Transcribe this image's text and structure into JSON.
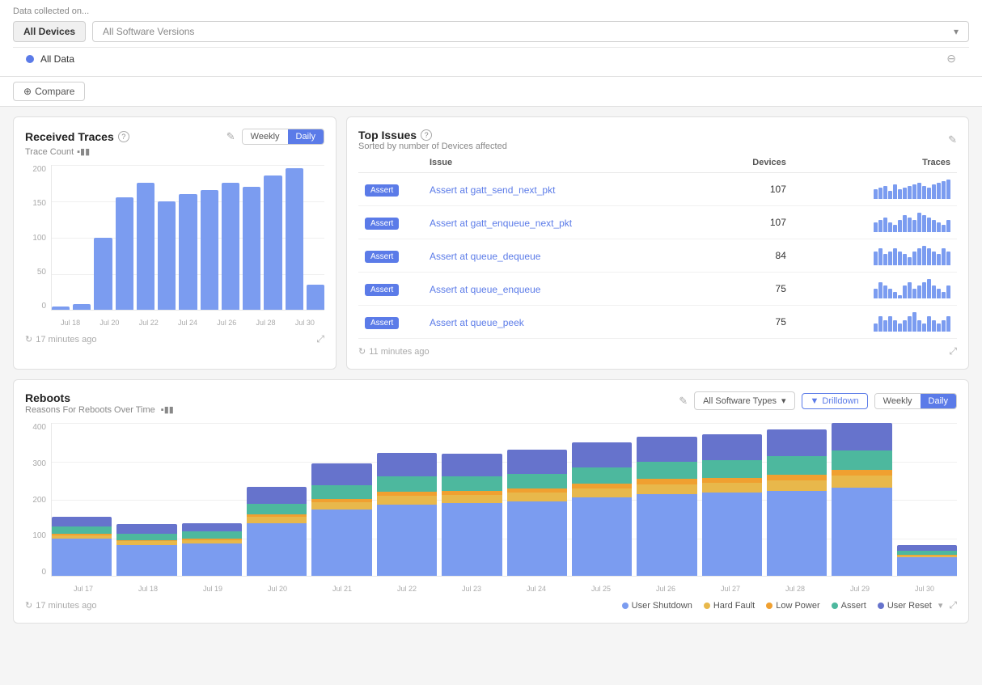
{
  "topbar": {
    "title": "Data collected on...",
    "all_devices_label": "All Devices",
    "all_software_versions_placeholder": "All Software Versions",
    "all_data_label": "All Data",
    "compare_label": "Compare"
  },
  "received_traces": {
    "title": "Received Traces",
    "subtitle": "Trace Count",
    "help": "?",
    "weekly_label": "Weekly",
    "daily_label": "Daily",
    "refresh_text": "17 minutes ago",
    "y_labels": [
      "200",
      "150",
      "100",
      "50",
      "0"
    ],
    "x_labels": [
      "Jul 18",
      "Jul 20",
      "Jul 22",
      "Jul 24",
      "Jul 26",
      "Jul 28",
      "Jul 30"
    ],
    "bars": [
      5,
      8,
      100,
      155,
      175,
      150,
      160,
      165,
      175,
      170,
      185,
      195,
      35
    ]
  },
  "top_issues": {
    "title": "Top Issues",
    "help": "?",
    "subtitle": "Sorted by number of Devices affected",
    "col_issue": "Issue",
    "col_devices": "Devices",
    "col_traces": "Traces",
    "refresh_text": "11 minutes ago",
    "rows": [
      {
        "badge": "Assert",
        "name": "Assert at gatt_send_next_pkt",
        "devices": 107,
        "bars": [
          6,
          7,
          8,
          5,
          9,
          6,
          7,
          8,
          9,
          10,
          8,
          7,
          9,
          10,
          11,
          12
        ]
      },
      {
        "badge": "Assert",
        "name": "Assert at gatt_enqueue_next_pkt",
        "devices": 107,
        "bars": [
          4,
          5,
          6,
          4,
          3,
          5,
          7,
          6,
          5,
          8,
          7,
          6,
          5,
          4,
          3,
          5
        ]
      },
      {
        "badge": "Assert",
        "name": "Assert at queue_dequeue",
        "devices": 84,
        "bars": [
          5,
          6,
          4,
          5,
          6,
          5,
          4,
          3,
          5,
          6,
          7,
          6,
          5,
          4,
          6,
          5
        ]
      },
      {
        "badge": "Assert",
        "name": "Assert at queue_enqueue",
        "devices": 75,
        "bars": [
          3,
          5,
          4,
          3,
          2,
          1,
          4,
          5,
          3,
          4,
          5,
          6,
          4,
          3,
          2,
          4
        ]
      },
      {
        "badge": "Assert",
        "name": "Assert at queue_peek",
        "devices": 75,
        "bars": [
          2,
          4,
          3,
          4,
          3,
          2,
          3,
          4,
          5,
          3,
          2,
          4,
          3,
          2,
          3,
          4
        ]
      }
    ]
  },
  "reboots": {
    "title": "Reboots",
    "subtitle": "Reasons For Reboots Over Time",
    "all_software_types": "All Software Types",
    "drilldown_label": "Drilldown",
    "weekly_label": "Weekly",
    "daily_label": "Daily",
    "refresh_text": "17 minutes ago",
    "y_labels": [
      "400",
      "300",
      "200",
      "100",
      "0"
    ],
    "x_labels": [
      "Jul 17",
      "Jul 18",
      "Jul 19",
      "Jul 20",
      "Jul 21",
      "Jul 22",
      "Jul 23",
      "Jul 24",
      "Jul 25",
      "Jul 26",
      "Jul 27",
      "Jul 28",
      "Jul 29",
      "Jul 30"
    ],
    "bars": [
      {
        "user_shutdown": 110,
        "hard_fault": 10,
        "low_power": 5,
        "assert": 20,
        "user_reset": 30
      },
      {
        "user_shutdown": 90,
        "hard_fault": 12,
        "low_power": 4,
        "assert": 18,
        "user_reset": 28
      },
      {
        "user_shutdown": 95,
        "hard_fault": 10,
        "low_power": 5,
        "assert": 20,
        "user_reset": 25
      },
      {
        "user_shutdown": 155,
        "hard_fault": 18,
        "low_power": 8,
        "assert": 30,
        "user_reset": 50
      },
      {
        "user_shutdown": 195,
        "hard_fault": 22,
        "low_power": 10,
        "assert": 40,
        "user_reset": 65
      },
      {
        "user_shutdown": 210,
        "hard_fault": 25,
        "low_power": 12,
        "assert": 45,
        "user_reset": 70
      },
      {
        "user_shutdown": 215,
        "hard_fault": 24,
        "low_power": 11,
        "assert": 42,
        "user_reset": 68
      },
      {
        "user_shutdown": 220,
        "hard_fault": 26,
        "low_power": 12,
        "assert": 43,
        "user_reset": 70
      },
      {
        "user_shutdown": 230,
        "hard_fault": 28,
        "low_power": 14,
        "assert": 48,
        "user_reset": 72
      },
      {
        "user_shutdown": 240,
        "hard_fault": 30,
        "low_power": 15,
        "assert": 50,
        "user_reset": 75
      },
      {
        "user_shutdown": 245,
        "hard_fault": 30,
        "low_power": 14,
        "assert": 52,
        "user_reset": 76
      },
      {
        "user_shutdown": 250,
        "hard_fault": 32,
        "low_power": 15,
        "assert": 55,
        "user_reset": 78
      },
      {
        "user_shutdown": 260,
        "hard_fault": 35,
        "low_power": 16,
        "assert": 58,
        "user_reset": 80
      },
      {
        "user_shutdown": 55,
        "hard_fault": 5,
        "low_power": 3,
        "assert": 10,
        "user_reset": 18
      }
    ],
    "legend": [
      {
        "key": "user_shutdown",
        "label": "User Shutdown",
        "color": "#7b9cf0"
      },
      {
        "key": "hard_fault",
        "label": "Hard Fault",
        "color": "#e8b84b"
      },
      {
        "key": "low_power",
        "label": "Low Power",
        "color": "#f0a030"
      },
      {
        "key": "assert",
        "label": "Assert",
        "color": "#4db89e"
      },
      {
        "key": "user_reset",
        "label": "User Reset",
        "color": "#6673cc"
      }
    ]
  }
}
